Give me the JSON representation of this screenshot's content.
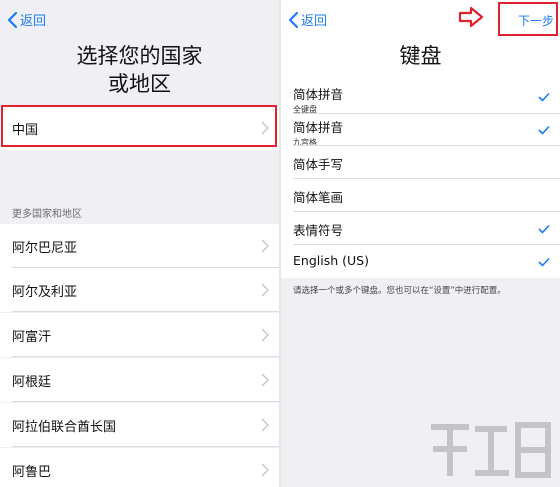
{
  "left": {
    "back_label": "返回",
    "title_line1": "选择您的国家",
    "title_line2": "或地区",
    "selected_country": "中国",
    "more_label": "更多国家和地区",
    "countries": [
      "阿尔巴尼亚",
      "阿尔及利亚",
      "阿富汗",
      "阿根廷",
      "阿拉伯联合酋长国",
      "阿鲁巴"
    ]
  },
  "right": {
    "back_label": "返回",
    "next_label": "下一步",
    "title": "键盘",
    "keyboards": [
      {
        "label": "简体拼音",
        "sub": "全键盘",
        "checked": true
      },
      {
        "label": "简体拼音",
        "sub": "九宫格",
        "checked": true
      },
      {
        "label": "简体手写",
        "sub": "",
        "checked": false
      },
      {
        "label": "简体笔画",
        "sub": "",
        "checked": false
      },
      {
        "label": "表情符号",
        "sub": "",
        "checked": true
      },
      {
        "label": "English (US)",
        "sub": "",
        "checked": true
      }
    ],
    "footer": "请选择一个或多个键盘。您也可以在“设置”中进行配置。"
  },
  "colors": {
    "accent": "#1a7cf5",
    "highlight": "#e0212e",
    "grouped_background": "#efeff4"
  }
}
